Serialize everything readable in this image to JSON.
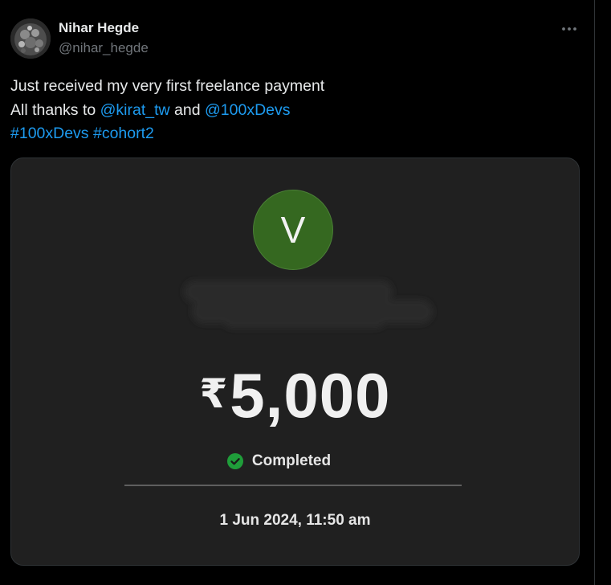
{
  "tweet": {
    "author": {
      "display_name": "Nihar Hegde",
      "handle": "@nihar_hegde",
      "avatar_icon": "profile-photo"
    },
    "more_icon": "more-horizontal-icon",
    "text": {
      "line1": "Just received my very first freelance payment",
      "line2_prefix": "All thanks to ",
      "mention1": "@kirat_tw",
      "line2_middle": " and ",
      "mention2": "@100xDevs",
      "hashtag1": "#100xDevs",
      "hashtag_sep": " ",
      "hashtag2": "#cohort2"
    },
    "link_color": "#1d9bf0"
  },
  "payment_card": {
    "avatar_letter": "V",
    "avatar_color": "#356820",
    "currency_symbol": "₹",
    "amount": "5,000",
    "status": "Completed",
    "status_icon": "check-circle-icon",
    "status_color": "#1f9d3a",
    "datetime": "1 Jun 2024, 11:50 am"
  }
}
